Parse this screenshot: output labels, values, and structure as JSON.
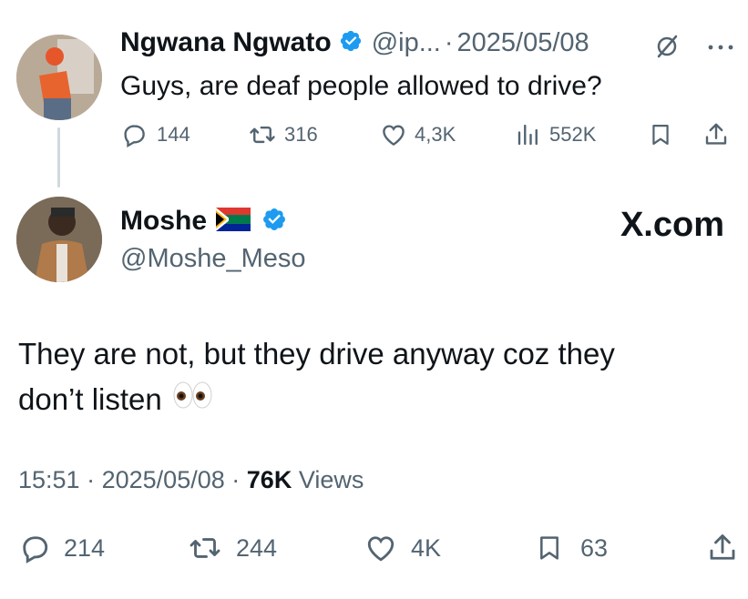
{
  "original_tweet": {
    "display_name": "Ngwana Ngwato",
    "handle": "@ip...",
    "separator": "·",
    "date": "2025/05/08",
    "text": "Guys, are deaf people allowed to drive?",
    "replies": "144",
    "retweets": "316",
    "likes": "4,3K",
    "views": "552K"
  },
  "reply_tweet": {
    "display_name": "Moshe",
    "flag": "south-africa-flag",
    "handle": "@Moshe_Meso",
    "text_line1": "They are not, but they drive anyway coz they",
    "text_line2": "don’t listen",
    "time": "15:51",
    "separator": "·",
    "date": "2025/05/08",
    "views_count": "76K",
    "views_label": "Views",
    "replies": "214",
    "retweets": "244",
    "likes": "4K",
    "bookmarks": "63"
  },
  "watermark": "X.com",
  "colors": {
    "verified": "#1d9bf0",
    "text": "#0f1419",
    "secondary": "#536471"
  },
  "icons": [
    "verified-badge-icon",
    "grok-icon",
    "more-icon",
    "reply-icon",
    "retweet-icon",
    "like-icon",
    "views-icon",
    "bookmark-icon",
    "share-icon",
    "eyes-emoji"
  ]
}
